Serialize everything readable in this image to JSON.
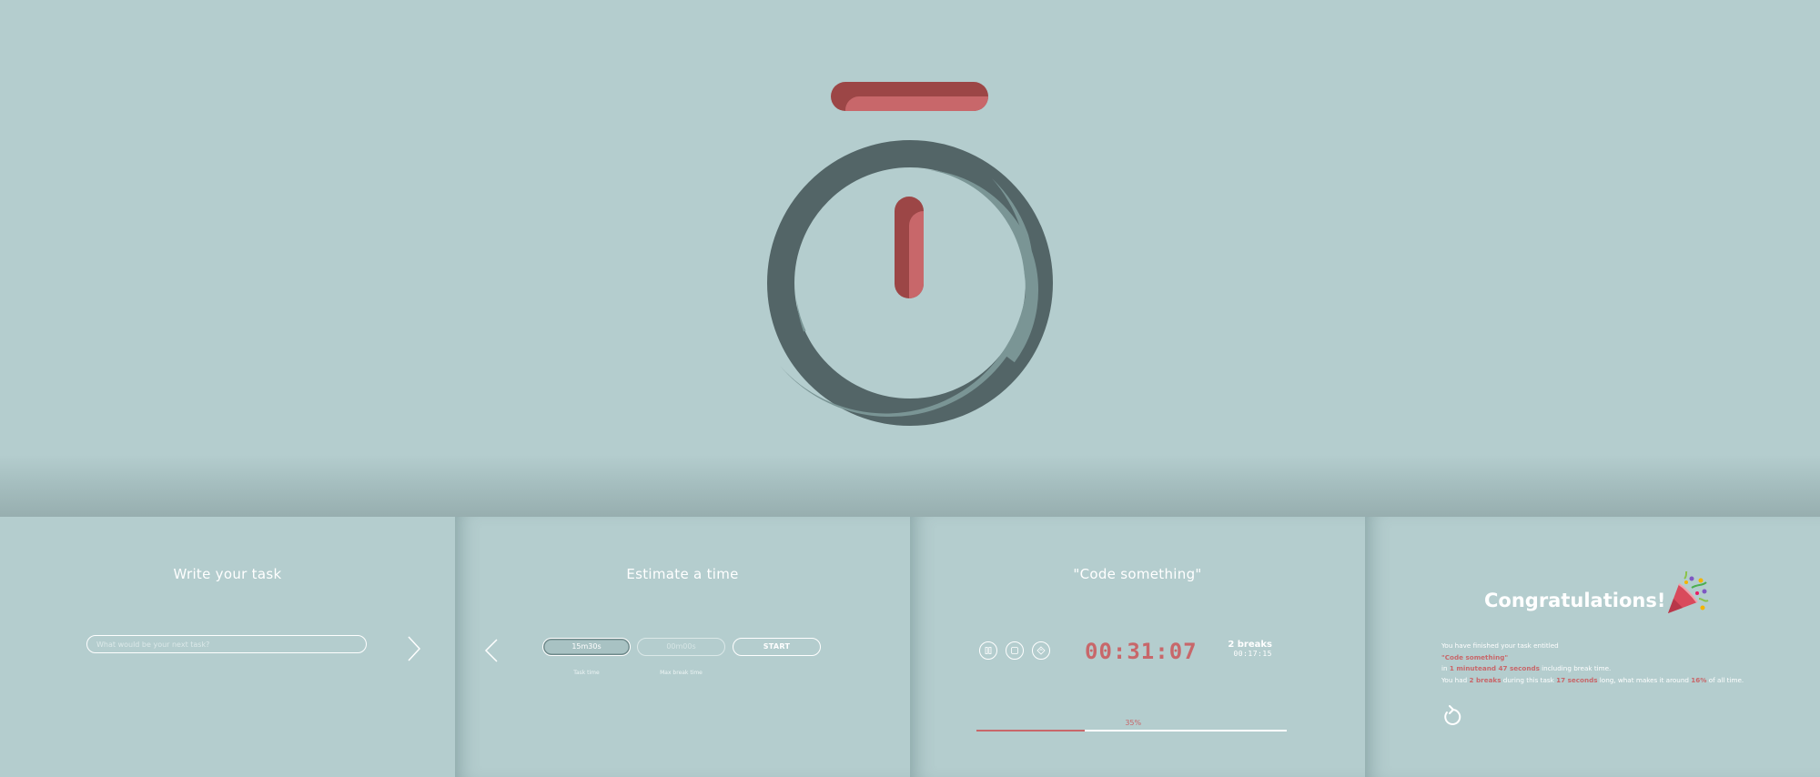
{
  "hero": {
    "colors": {
      "accent": "#c8676a",
      "accent_dark": "#9c4646",
      "ring_dark": "#536567",
      "ring_light": "#7a9595"
    }
  },
  "panel_task": {
    "heading": "Write your task",
    "input_placeholder": "What would be your next task?",
    "next_icon": "chevron-right-icon"
  },
  "panel_estimate": {
    "heading": "Estimate a time",
    "task_time_value": "15m30s",
    "max_break_value": "00m00s",
    "start_label": "START",
    "task_time_label": "Task time",
    "max_break_label": "Max break time",
    "back_icon": "chevron-left-icon"
  },
  "panel_running": {
    "heading": "\"Code something\"",
    "controls": [
      "pause-icon",
      "stop-icon",
      "reset-icon"
    ],
    "timer": "00:31:07",
    "breaks_count": "2 breaks",
    "breaks_time": "00:17:15",
    "progress": 35,
    "progress_label": "35%"
  },
  "panel_done": {
    "heading": "Congratulations!",
    "line1": "You have finished your task entitled",
    "task_name": "\"Code something\"",
    "line2_prefix": "in",
    "duration": "1 minuteand 47 seconds",
    "line2_suffix": "including break time.",
    "line3_prefix": "You had",
    "breaks": "2 breaks",
    "line3_mid": "during this task",
    "break_length": "17 seconds",
    "line3_suffix": "long, what makes it around",
    "break_percent": "16%",
    "line3_end": "of all time.",
    "restart_icon": "restart-icon",
    "party_icon": "party-popper-icon"
  }
}
